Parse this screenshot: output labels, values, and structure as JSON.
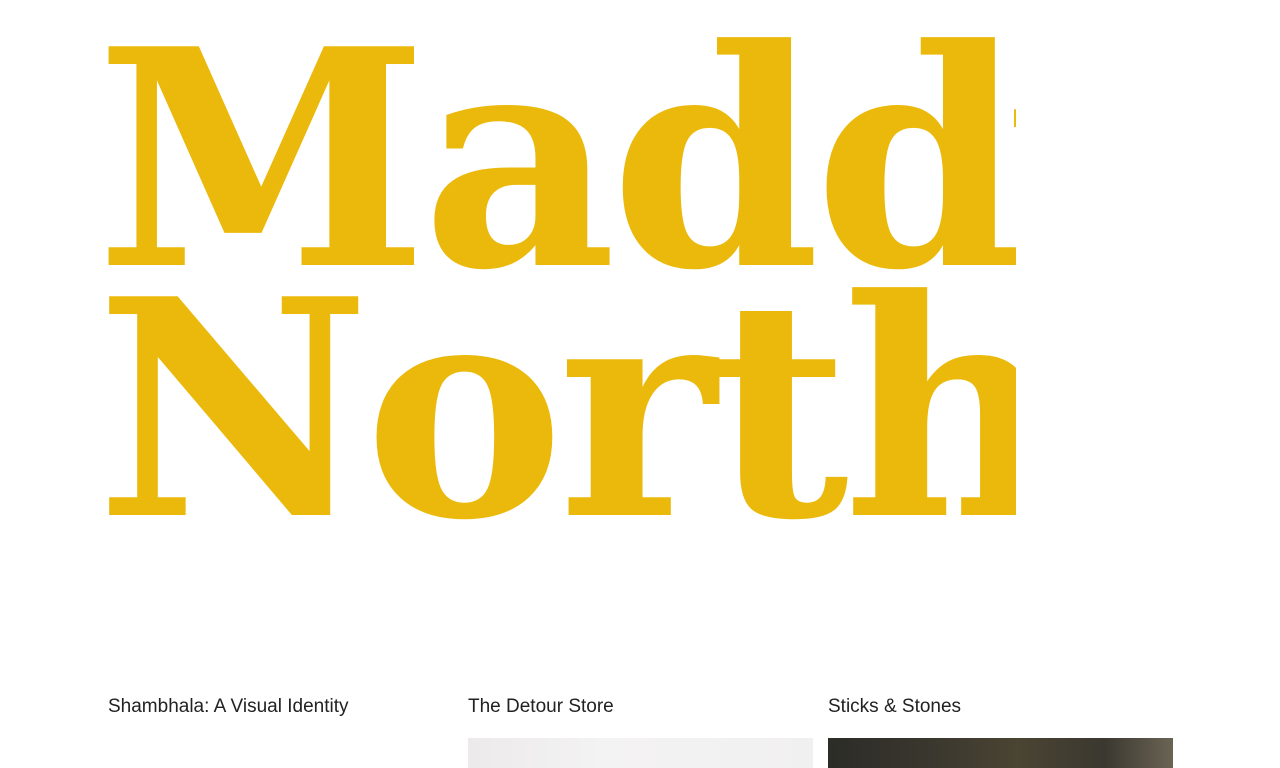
{
  "site": {
    "logo": {
      "line1": "Maddy",
      "line2": "North",
      "color": "#ebb90c"
    }
  },
  "projects": [
    {
      "title": "Shambhala: A Visual Identity",
      "has_thumbnail": false
    },
    {
      "title": "The Detour Store",
      "has_thumbnail": true
    },
    {
      "title": "Sticks & Stones",
      "has_thumbnail": true
    }
  ]
}
